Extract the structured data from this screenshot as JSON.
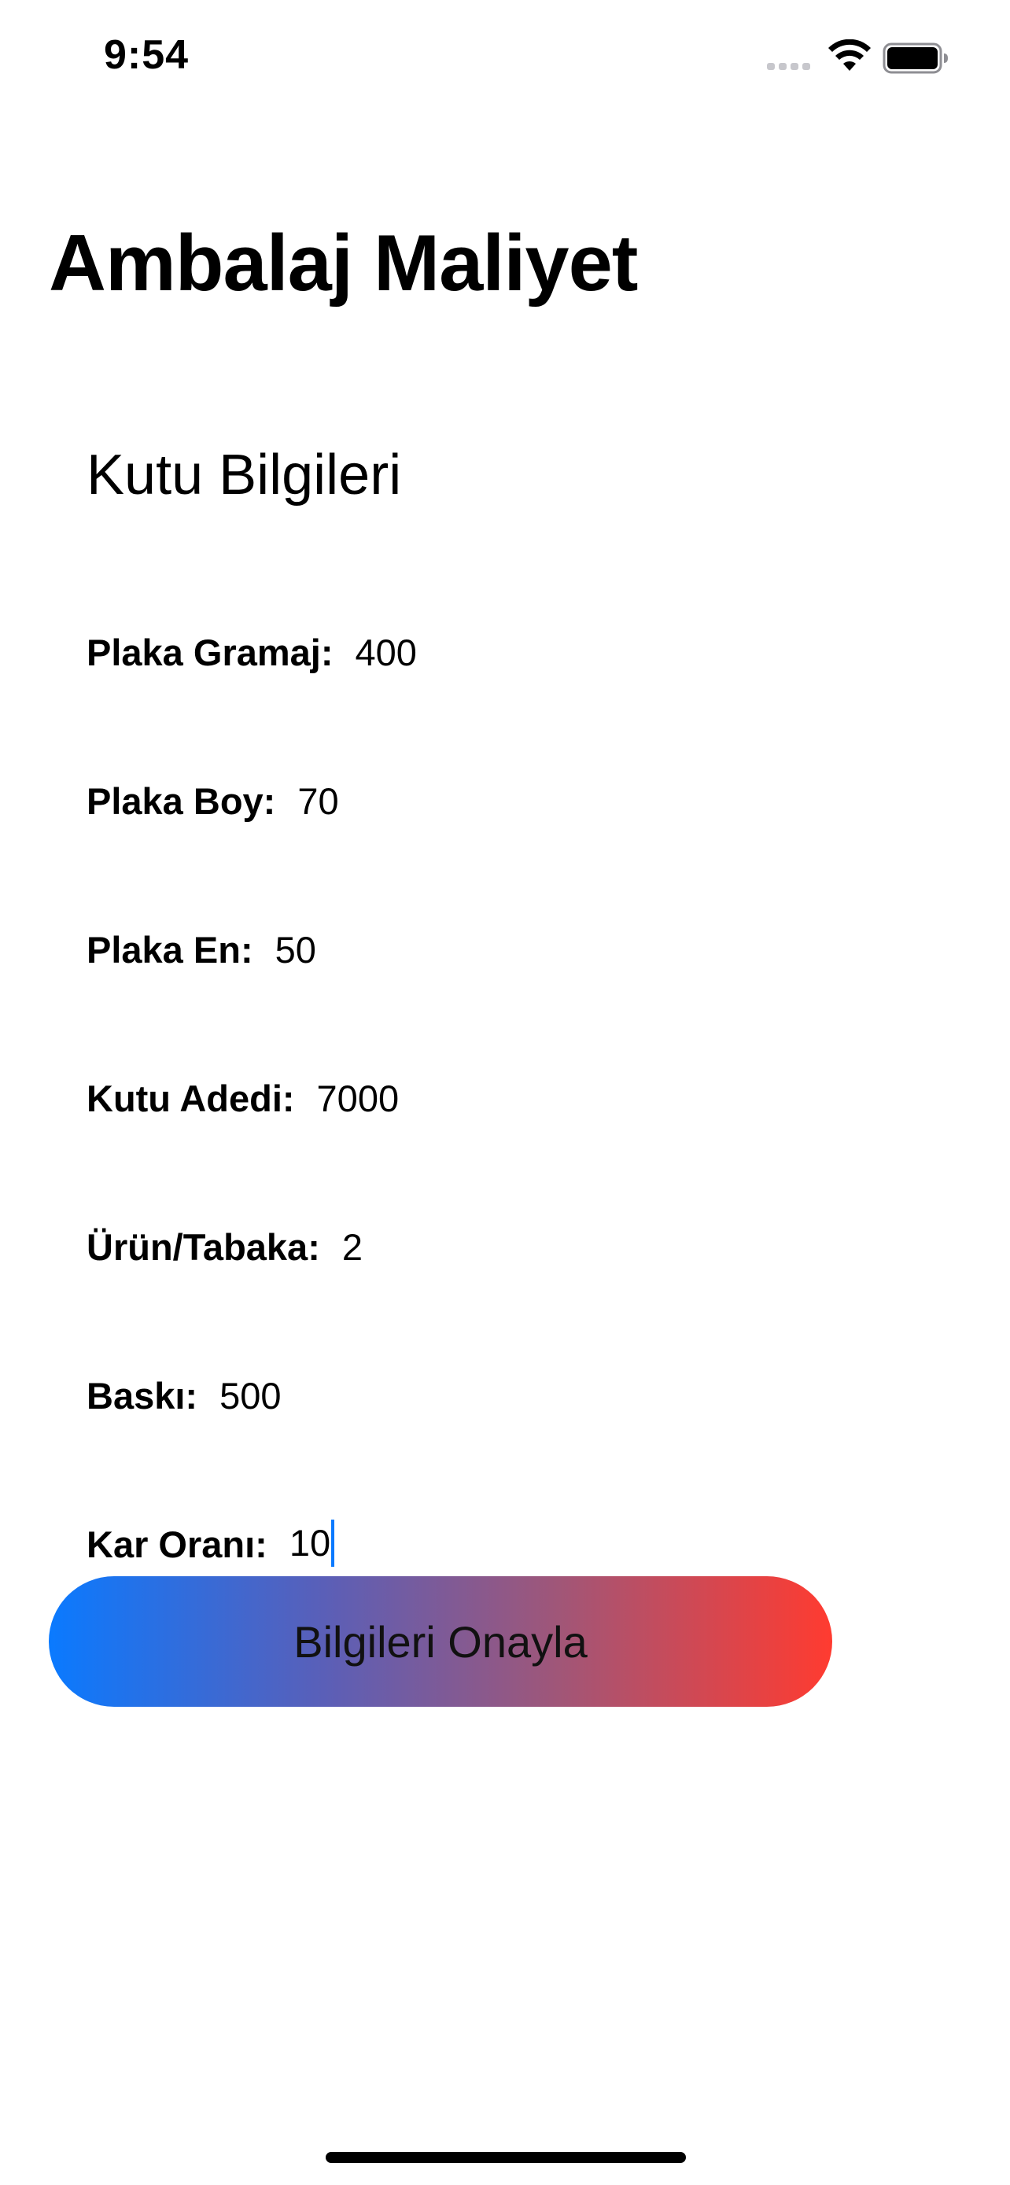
{
  "status_bar": {
    "time": "9:54"
  },
  "app": {
    "title": "Ambalaj Maliyet"
  },
  "section": {
    "title": "Kutu Bilgileri"
  },
  "fields": [
    {
      "label": "Plaka Gramaj:",
      "value": "400"
    },
    {
      "label": "Plaka Boy:",
      "value": "70"
    },
    {
      "label": "Plaka En:",
      "value": "50"
    },
    {
      "label": "Kutu Adedi:",
      "value": "7000"
    },
    {
      "label": "Ürün/Tabaka:",
      "value": "2"
    },
    {
      "label": "Baskı:",
      "value": "500"
    },
    {
      "label": "Kar Oranı:",
      "value": "10"
    }
  ],
  "button": {
    "label": "Bilgileri Onayla"
  },
  "colors": {
    "gradient_start": "#0a7aff",
    "gradient_end": "#ff3b30",
    "caret": "#0a7aff"
  },
  "icons": {
    "signal": "cellular-signal-icon",
    "wifi": "wifi-icon",
    "battery": "battery-icon"
  }
}
